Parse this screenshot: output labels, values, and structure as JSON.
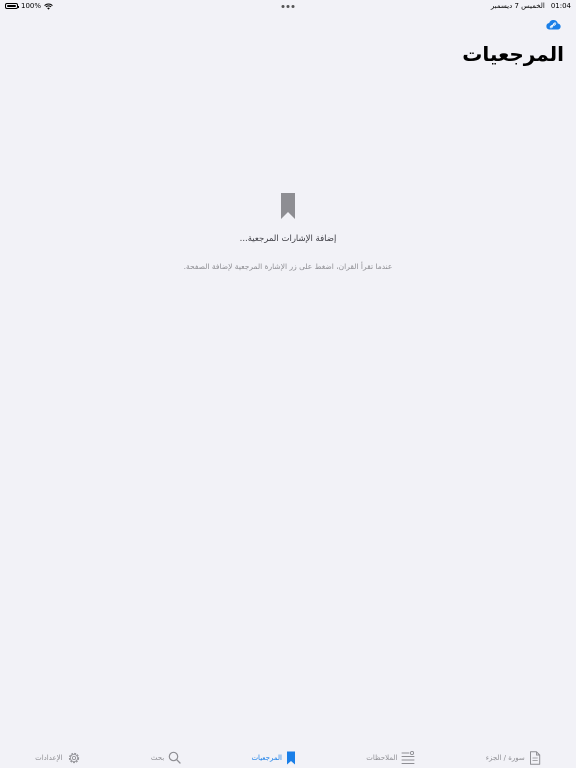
{
  "status_bar": {
    "time": "01:04",
    "date": "الخميس 7 ديسمبر",
    "battery": "100%"
  },
  "header": {
    "title": "المرجعيات",
    "cloud_icon": "cloud-link-icon"
  },
  "empty_state": {
    "icon": "bookmark-icon",
    "title": "إضافة الإشارات المرجعية...",
    "subtitle": "عندما تقرأ القران، اضغط على زر الإشارة المرجعية لإضافة الصفحة."
  },
  "tab_bar": {
    "tabs": [
      {
        "label": "سورة / الجزء",
        "icon": "document-icon",
        "active": false
      },
      {
        "label": "الملاحظات",
        "icon": "notes-icon",
        "active": false
      },
      {
        "label": "المرجعيات",
        "icon": "bookmark-icon",
        "active": true
      },
      {
        "label": "بحث",
        "icon": "search-icon",
        "active": false
      },
      {
        "label": "الإعدادات",
        "icon": "gear-icon",
        "active": false
      }
    ]
  },
  "colors": {
    "accent": "#1a7fe8",
    "background": "#f2f2f7",
    "icon_gray": "#8e8e93"
  }
}
